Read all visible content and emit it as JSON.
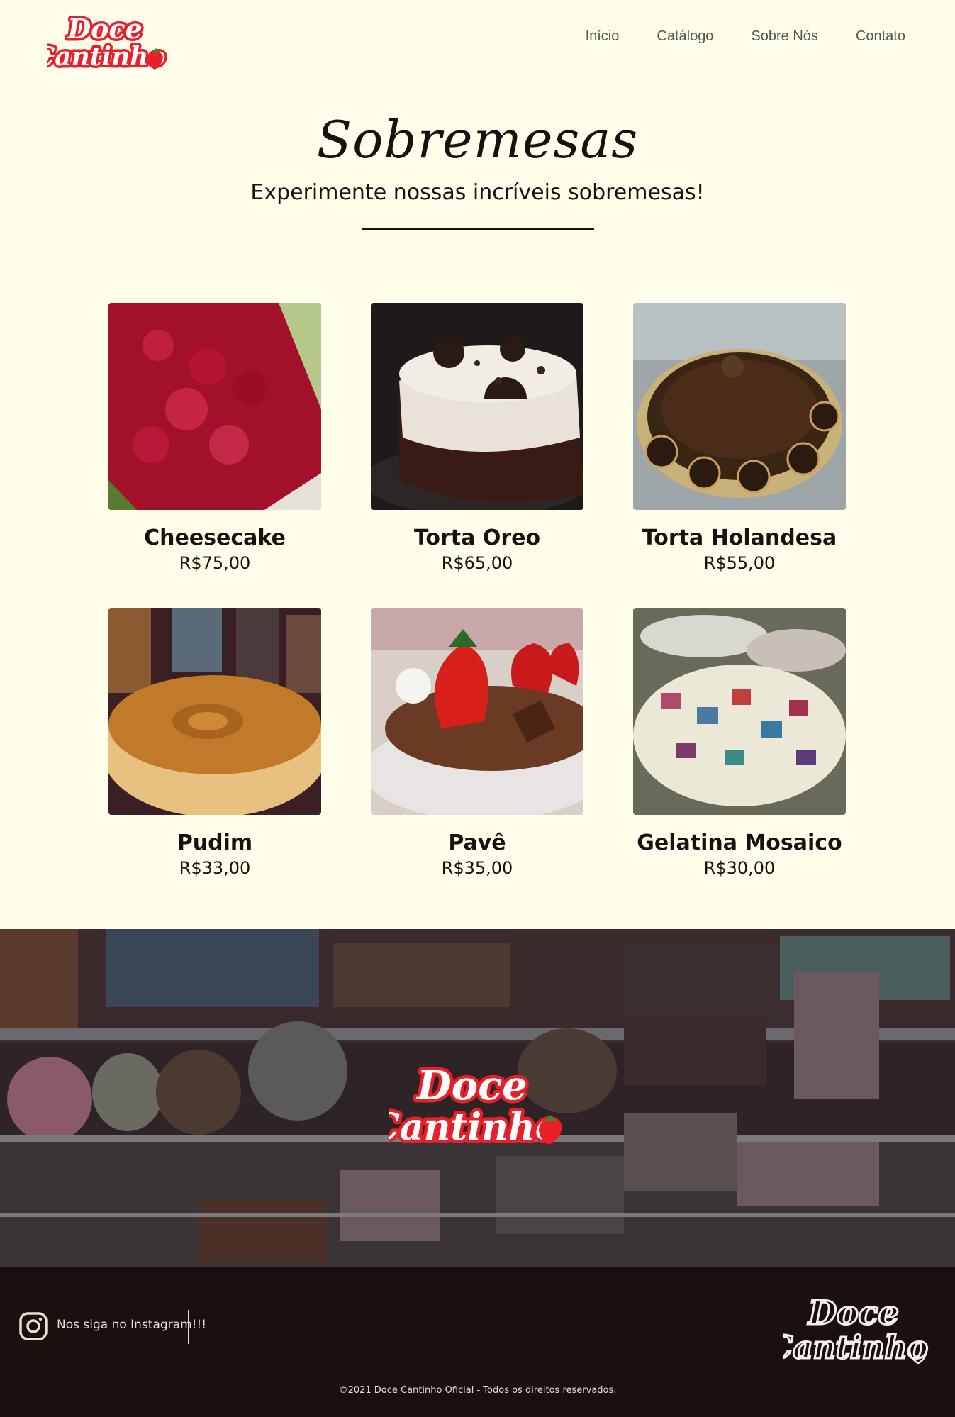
{
  "brand": {
    "logo_text_line1": "Doce",
    "logo_text_line2": "Cantinho"
  },
  "nav": {
    "items": [
      "Início",
      "Catálogo",
      "Sobre Nós",
      "Contato"
    ]
  },
  "section": {
    "title": "Sobremesas",
    "subtitle": "Experimente nossas incríveis sobremesas!"
  },
  "products": [
    {
      "name": "Cheesecake",
      "price": "R$75,00"
    },
    {
      "name": "Torta Oreo",
      "price": "R$65,00"
    },
    {
      "name": "Torta Holandesa",
      "price": "R$55,00"
    },
    {
      "name": "Pudim",
      "price": "R$33,00"
    },
    {
      "name": "Pavê",
      "price": "R$35,00"
    },
    {
      "name": "Gelatina Mosaico",
      "price": "R$30,00"
    }
  ],
  "footer": {
    "instagram_label": "Nos siga no Instagram!!!",
    "copyright": "©2021 Doce Cantinho Oficial - Todos os direitos reservados."
  },
  "colors": {
    "background": "#fefeeb",
    "footer": "#1c0f0f",
    "logo_red": "#e8202a"
  }
}
